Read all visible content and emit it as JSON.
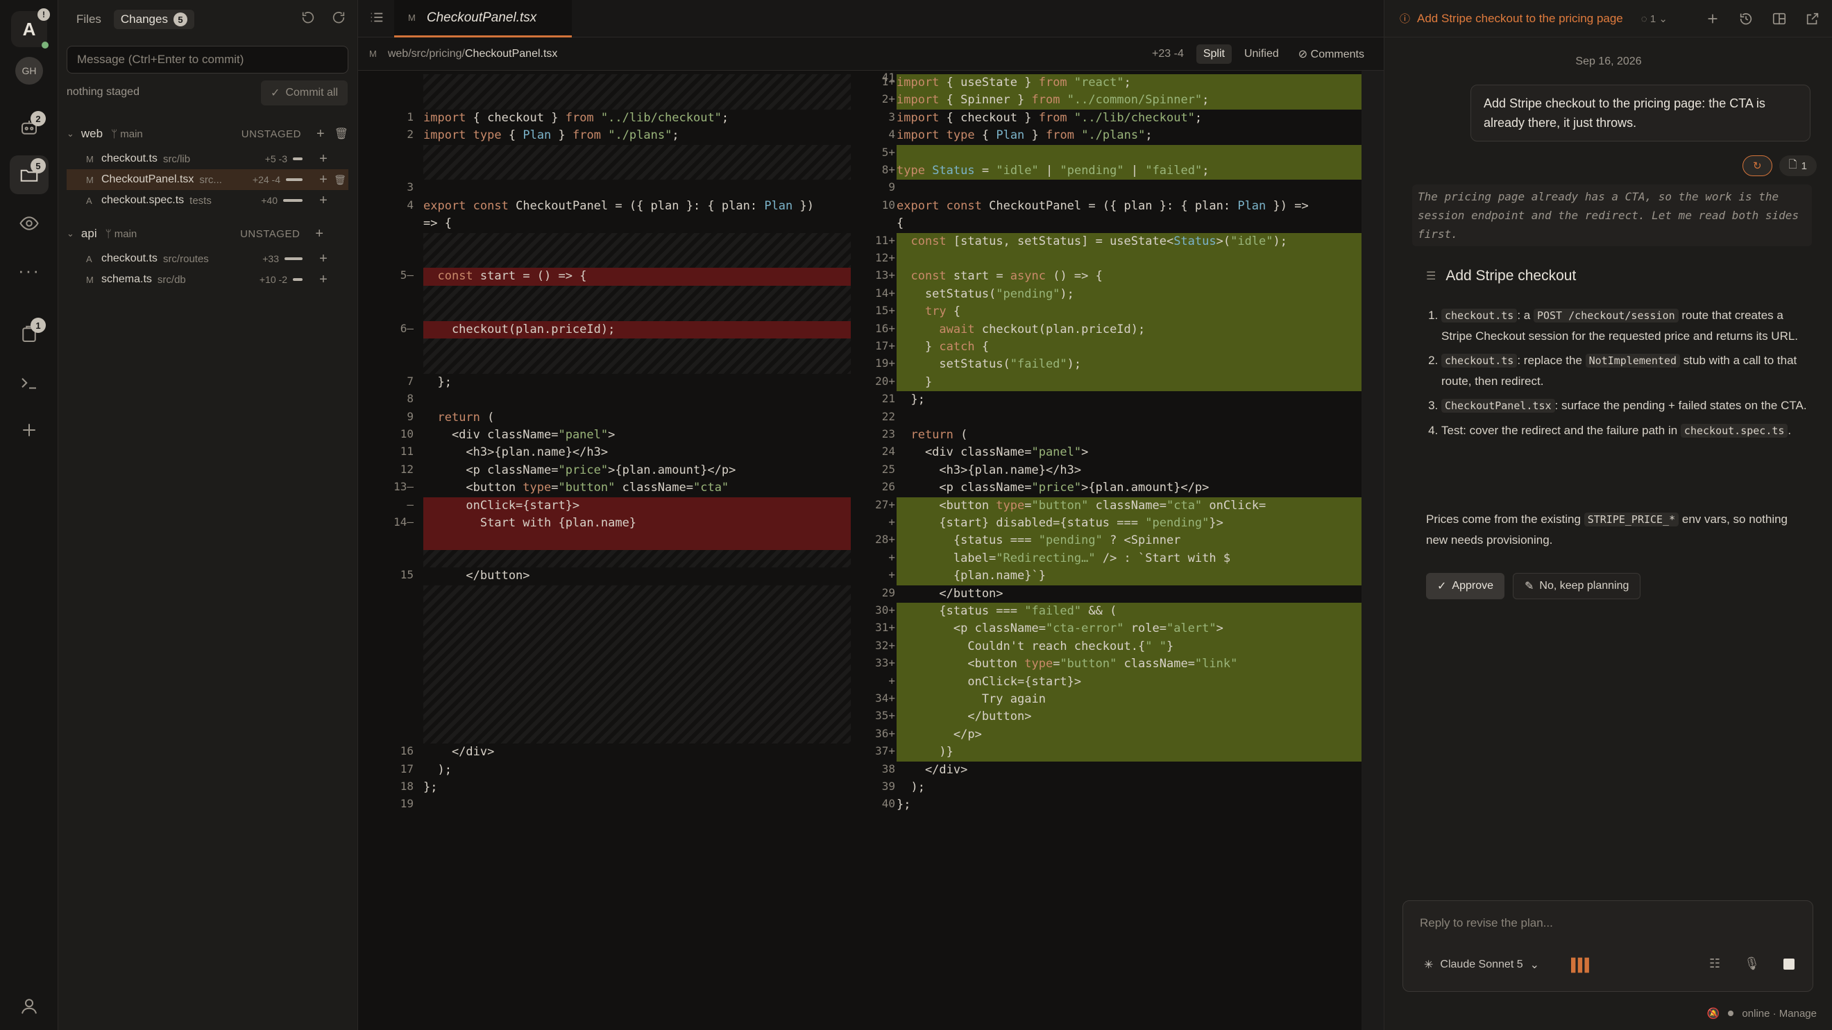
{
  "rail": {
    "avatar_letter": "A",
    "gh_label": "GH",
    "badge_agents": "2",
    "badge_changes": "5",
    "badge_tasks": "1"
  },
  "changes": {
    "tab_files": "Files",
    "tab_changes": "Changes",
    "changes_count": "5",
    "commit_placeholder": "Message (Ctrl+Enter to commit)",
    "nothing_staged": "nothing staged",
    "commit_all": "Commit all",
    "groups": [
      {
        "name": "web",
        "branch": "main",
        "status": "UNSTAGED",
        "files": [
          {
            "st": "M",
            "name": "checkout.ts",
            "path": "src/lib",
            "stat": "+5 -3"
          },
          {
            "st": "M",
            "name": "CheckoutPanel.tsx",
            "path": "src...",
            "stat": "+24 -4"
          },
          {
            "st": "A",
            "name": "checkout.spec.ts",
            "path": "tests",
            "stat": "+40"
          }
        ]
      },
      {
        "name": "api",
        "branch": "main",
        "status": "UNSTAGED",
        "files": [
          {
            "st": "A",
            "name": "checkout.ts",
            "path": "src/routes",
            "stat": "+33"
          },
          {
            "st": "M",
            "name": "schema.ts",
            "path": "src/db",
            "stat": "+10 -2"
          }
        ]
      }
    ]
  },
  "editor": {
    "tab_status": "M",
    "tab_name": "CheckoutPanel.tsx",
    "path_status": "M",
    "path_dir": "web/src/pricing/",
    "path_file": "CheckoutPanel.tsx",
    "diff_stat": "+23 -4",
    "view_split": "Split",
    "view_unified": "Unified",
    "comments": "Comments"
  },
  "diff_left": [
    {
      "n": "1",
      "code": "import { checkout } from \"../lib/checkout\";"
    },
    {
      "n": "2",
      "code": "import type { Plan } from \"./plans\";"
    },
    {
      "n": "3",
      "code": ""
    },
    {
      "n": "4",
      "code": "export const CheckoutPanel = ({ plan }: { plan: Plan })"
    },
    {
      "n": "",
      "code": "=> {"
    },
    {
      "n": "5",
      "code": "  const start = () => {"
    },
    {
      "n": "6",
      "code": "    checkout(plan.priceId);"
    },
    {
      "n": "7",
      "code": "  };"
    },
    {
      "n": "8",
      "code": ""
    },
    {
      "n": "9",
      "code": "  return ("
    },
    {
      "n": "10",
      "code": "    <div className=\"panel\">"
    },
    {
      "n": "11",
      "code": "      <h3>{plan.name}</h3>"
    },
    {
      "n": "12",
      "code": "      <p className=\"price\">{plan.amount}</p>"
    },
    {
      "n": "13",
      "code": "      <button type=\"button\" className=\"cta\""
    },
    {
      "n": "",
      "code": "      onClick={start}>"
    },
    {
      "n": "14",
      "code": "        Start with {plan.name}"
    },
    {
      "n": "15",
      "code": "      </button>"
    },
    {
      "n": "16",
      "code": "    </div>"
    },
    {
      "n": "17",
      "code": "  );"
    },
    {
      "n": "18",
      "code": "};"
    },
    {
      "n": "19",
      "code": ""
    }
  ],
  "diff_right": [
    {
      "n": "1",
      "code": "import { useState } from \"react\";"
    },
    {
      "n": "2",
      "code": "import { Spinner } from \"../common/Spinner\";"
    },
    {
      "n": "3",
      "code": "import { checkout } from \"../lib/checkout\";"
    },
    {
      "n": "4",
      "code": "import type { Plan } from \"./plans\";"
    },
    {
      "n": "5",
      "code": ""
    },
    {
      "n": "8",
      "code": "type Status = \"idle\" | \"pending\" | \"failed\";"
    },
    {
      "n": "9",
      "code": ""
    },
    {
      "n": "10",
      "code": "export const CheckoutPanel = ({ plan }: { plan: Plan }) =>"
    },
    {
      "n": "",
      "code": "{"
    },
    {
      "n": "11",
      "code": "  const [status, setStatus] = useState<Status>(\"idle\");"
    },
    {
      "n": "12",
      "code": ""
    },
    {
      "n": "13",
      "code": "  const start = async () => {"
    },
    {
      "n": "14",
      "code": "    setStatus(\"pending\");"
    },
    {
      "n": "15",
      "code": "    try {"
    },
    {
      "n": "16",
      "code": "      await checkout(plan.priceId);"
    },
    {
      "n": "17",
      "code": "    } catch {"
    },
    {
      "n": "19",
      "code": "      setStatus(\"failed\");"
    },
    {
      "n": "20",
      "code": "    }"
    },
    {
      "n": "21",
      "code": "  };"
    },
    {
      "n": "22",
      "code": ""
    },
    {
      "n": "23",
      "code": "  return ("
    },
    {
      "n": "24",
      "code": "    <div className=\"panel\">"
    },
    {
      "n": "25",
      "code": "      <h3>{plan.name}</h3>"
    },
    {
      "n": "26",
      "code": "      <p className=\"price\">{plan.amount}</p>"
    },
    {
      "n": "27",
      "code": "      <button type=\"button\" className=\"cta\" onClick="
    },
    {
      "n": "",
      "code": "      {start} disabled={status === \"pending\"}>"
    },
    {
      "n": "28",
      "code": "        {status === \"pending\" ? <Spinner"
    },
    {
      "n": "",
      "code": "        label=\"Redirecting…\" /> : `Start with $"
    },
    {
      "n": "",
      "code": "        {plan.name}`}"
    },
    {
      "n": "29",
      "code": "      </button>"
    },
    {
      "n": "30",
      "code": "      {status === \"failed\" && ("
    },
    {
      "n": "31",
      "code": "        <p className=\"cta-error\" role=\"alert\">"
    },
    {
      "n": "32",
      "code": "          Couldn't reach checkout.{\" \"}"
    },
    {
      "n": "33",
      "code": "          <button type=\"button\" className=\"link\""
    },
    {
      "n": "",
      "code": "          onClick={start}>"
    },
    {
      "n": "34",
      "code": "            Try again"
    },
    {
      "n": "35",
      "code": "          </button>"
    },
    {
      "n": "36",
      "code": "        </p>"
    },
    {
      "n": "37",
      "code": "      )}"
    },
    {
      "n": "38",
      "code": "    </div>"
    },
    {
      "n": "39",
      "code": "  );"
    },
    {
      "n": "40",
      "code": "};"
    },
    {
      "n": "41",
      "code": ""
    }
  ],
  "chat": {
    "title": "Add Stripe checkout to the pricing page",
    "spinner_count": "1",
    "date": "Sep 16, 2026",
    "user_message": "Add Stripe checkout to the pricing page: the CTA is already there, it just throws.",
    "files_count": "1",
    "thinking": "The pricing page already has a CTA, so the work is the session endpoint and the redirect. Let me read both sides first.",
    "plan_title": "Add Stripe checkout",
    "plan": [
      {
        "code": "checkout.ts",
        "text_pre": ": a ",
        "code2": "POST /checkout/session",
        "text_post": " route that creates a Stripe Checkout session for the requested price and returns its URL."
      },
      {
        "code": "checkout.ts",
        "text_pre": ": replace the ",
        "code2": "NotImplemented",
        "text_post": " stub with a call to that route, then redirect."
      },
      {
        "code": "CheckoutPanel.tsx",
        "text_pre": ": surface the pending + failed states on the CTA.",
        "code2": "",
        "text_post": ""
      },
      {
        "code": "",
        "text_pre": "Test: cover the redirect and the failure path in ",
        "code2": "checkout.spec.ts",
        "text_post": "."
      }
    ],
    "note_pre": "Prices come from the existing ",
    "note_code": "STRIPE_PRICE_*",
    "note_post": " env vars, so nothing new needs provisioning.",
    "approve": "Approve",
    "keep_planning": "No, keep planning",
    "reply_placeholder": "Reply to revise the plan...",
    "model": "Claude Sonnet 5",
    "footer_status": "online · Manage"
  }
}
